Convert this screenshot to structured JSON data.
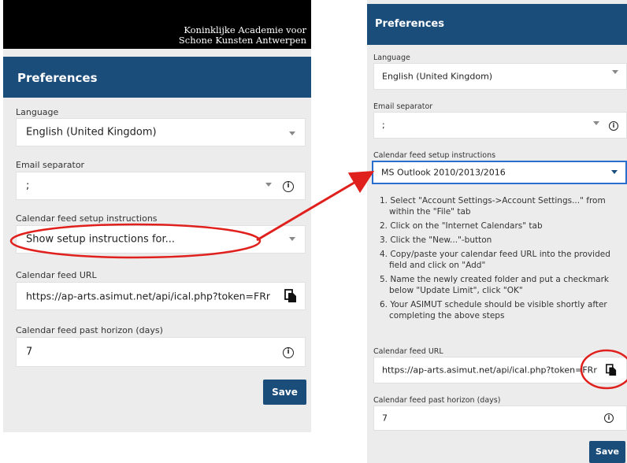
{
  "brand": {
    "line1": "Koninklijke Academie voor",
    "line2": "Schone Kunsten Antwerpen"
  },
  "left": {
    "title": "Preferences",
    "language_label": "Language",
    "language_value": "English (United Kingdom)",
    "email_label": "Email separator",
    "email_value": ";",
    "calendar_instr_label": "Calendar feed setup instructions",
    "calendar_instr_value": "Show setup instructions for...",
    "feed_url_label": "Calendar feed URL",
    "feed_url_value": "https://ap-arts.asimut.net/api/ical.php?token=FRr",
    "horizon_label": "Calendar feed past horizon (days)",
    "horizon_value": "7",
    "save_label": "Save"
  },
  "right": {
    "title": "Preferences",
    "language_label": "Language",
    "language_value": "English (United Kingdom)",
    "email_label": "Email separator",
    "email_value": ";",
    "calendar_instr_label": "Calendar feed setup instructions",
    "calendar_instr_value": "MS Outlook 2010/2013/2016",
    "instructions": [
      "1. Select \"Account Settings->Account Settings...\" from within the \"File\" tab",
      "2. Click on the \"Internet Calendars\" tab",
      "3. Click the \"New...\"-button",
      "4. Copy/paste your calendar feed URL into the provided field and click on \"Add\"",
      "5. Name the newly created folder and put a checkmark below \"Update Limit\", click \"OK\"",
      "6. Your ASIMUT schedule should be visible shortly after completing the above steps"
    ],
    "feed_url_label": "Calendar feed URL",
    "feed_url_value": "https://ap-arts.asimut.net/api/ical.php?token=FRr",
    "horizon_label": "Calendar feed past horizon (days)",
    "horizon_value": "7",
    "save_label": "Save"
  },
  "colors": {
    "header": "#1b4d7a",
    "annotation": "#e0201c",
    "focus": "#2a6fd0"
  },
  "icons": {
    "info": "info-icon",
    "copy": "copy-icon",
    "dropdown": "caret-down-icon"
  }
}
